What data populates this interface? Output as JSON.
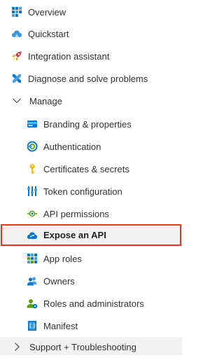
{
  "nav": {
    "items": [
      {
        "label": "Overview",
        "icon": "overview-grid-icon"
      },
      {
        "label": "Quickstart",
        "icon": "cloud-quickstart-icon"
      },
      {
        "label": "Integration assistant",
        "icon": "rocket-icon"
      },
      {
        "label": "Diagnose and solve problems",
        "icon": "wrench-icon"
      }
    ],
    "manage": {
      "label": "Manage",
      "icon": "chevron-down-icon",
      "items": [
        {
          "label": "Branding & properties",
          "icon": "branding-card-icon"
        },
        {
          "label": "Authentication",
          "icon": "authentication-icon"
        },
        {
          "label": "Certificates & secrets",
          "icon": "key-icon"
        },
        {
          "label": "Token configuration",
          "icon": "token-bars-icon"
        },
        {
          "label": "API permissions",
          "icon": "api-permissions-icon"
        },
        {
          "label": "Expose an API",
          "icon": "cloud-api-icon",
          "selected": true
        },
        {
          "label": "App roles",
          "icon": "app-roles-grid-icon"
        },
        {
          "label": "Owners",
          "icon": "owners-people-icon"
        },
        {
          "label": "Roles and administrators",
          "icon": "roles-admin-icon"
        },
        {
          "label": "Manifest",
          "icon": "manifest-icon"
        }
      ]
    },
    "support": {
      "label": "Support + Troubleshooting",
      "icon": "chevron-right-icon"
    }
  },
  "colors": {
    "highlight_border": "#e8361e",
    "selected_bg": "#f3f2f1",
    "azure_blue": "#0078d4"
  }
}
